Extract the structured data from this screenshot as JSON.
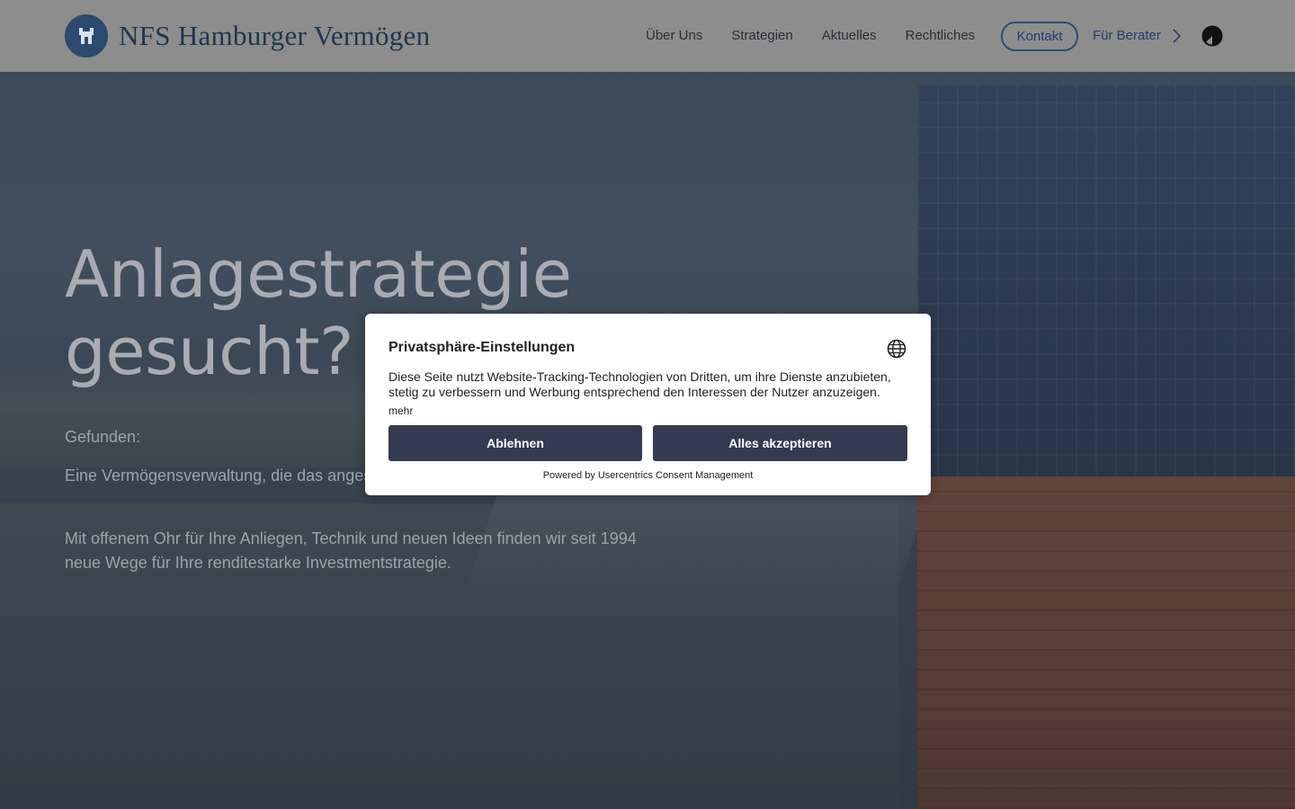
{
  "header": {
    "logo_text": "NFS Hamburger Vermögen",
    "nav": [
      {
        "label": "Über Uns"
      },
      {
        "label": "Strategien"
      },
      {
        "label": "Aktuelles"
      },
      {
        "label": "Rechtliches"
      }
    ],
    "kontakt_label": "Kontakt",
    "berater_label": "Für Berater"
  },
  "hero": {
    "title_line1": "Anlagestrategie",
    "title_line2": "gesucht?",
    "found_label": "Gefunden:",
    "paragraph1": "Eine Vermögensverwaltung, die das angestaubte Image hinter sich gelassen hat.",
    "paragraph2": "Mit offenem Ohr für Ihre Anliegen, Technik und neuen Ideen finden wir seit 1994 neue Wege für Ihre renditestarke Investmentstrategie."
  },
  "consent": {
    "title": "Privatsphäre-Einstellungen",
    "text": "Diese Seite nutzt Website-Tracking-Technologien von Dritten, um ihre Dienste anzubieten, stetig zu verbessern und Werbung entsprechend den Interessen der Nutzer anzuzeigen.",
    "more_label": "mehr",
    "deny_label": "Ablehnen",
    "accept_label": "Alles akzeptieren",
    "powered_by": "Powered by Usercentrics Consent Management"
  },
  "colors": {
    "header_bg": "#8d8d8d",
    "brand_blue": "#1f3f73",
    "button_dark": "#343a52"
  },
  "icons": {
    "logo": "city-crest-icon",
    "berater": "chevron-right-icon",
    "theme": "contrast-toggle-icon",
    "language": "globe-icon"
  }
}
